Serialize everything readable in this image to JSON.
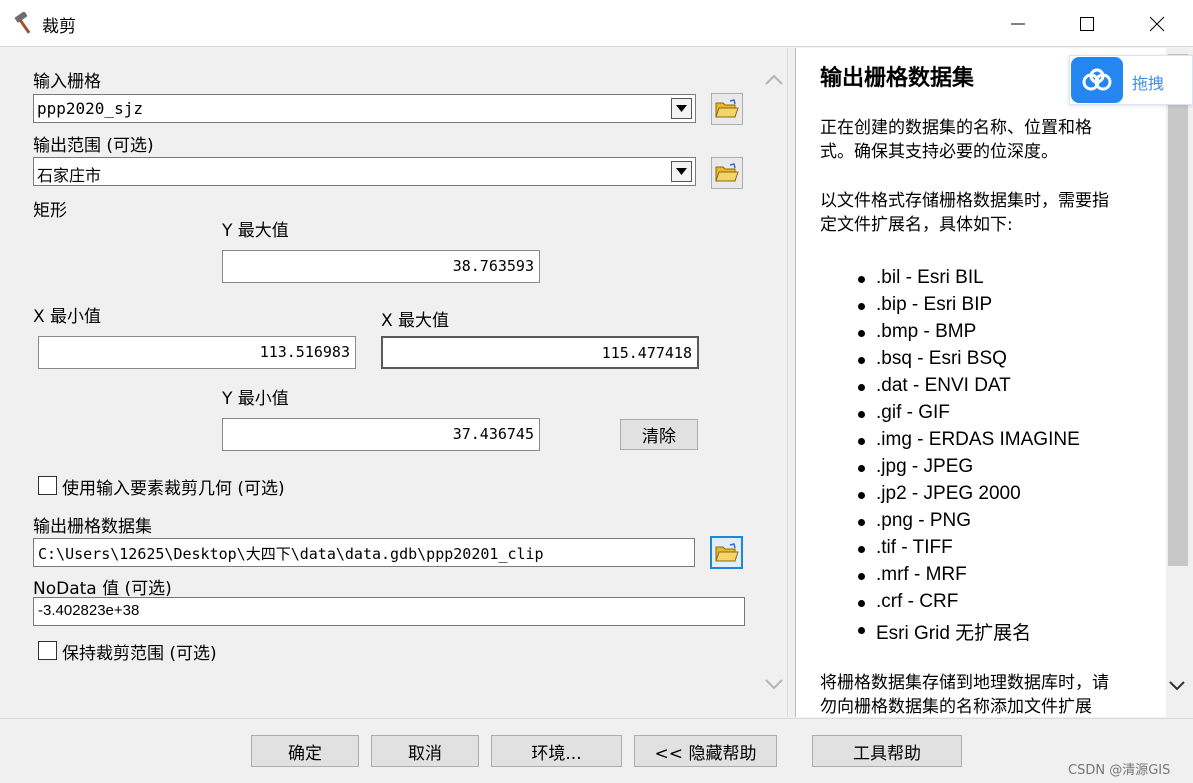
{
  "window": {
    "title": "裁剪",
    "controls": [
      "minimize-icon",
      "maximize-icon",
      "close-icon"
    ]
  },
  "form": {
    "input_raster": {
      "label": "输入栅格",
      "value": "ppp2020_sjz"
    },
    "output_extent": {
      "label": "输出范围 (可选)",
      "value": "石家庄市"
    },
    "rectangle": {
      "label": "矩形",
      "y_max_label": "Y 最大值",
      "y_max": "38.763593",
      "x_min_label": "X 最小值",
      "x_min": "113.516983",
      "x_max_label": "X 最大值",
      "x_max": "115.477418",
      "y_min_label": "Y 最小值",
      "y_min": "37.436745",
      "clear_label": "清除"
    },
    "use_input_features": {
      "label": "使用输入要素裁剪几何 (可选)",
      "checked": false
    },
    "output_raster": {
      "label": "输出栅格数据集",
      "value": "C:\\Users\\12625\\Desktop\\大四下\\data\\data.gdb\\ppp20201_clip"
    },
    "nodata": {
      "label": "NoData 值 (可选)",
      "value": "-3.402823e+38"
    },
    "maintain_extent": {
      "label": "保持裁剪范围 (可选)",
      "checked": false
    }
  },
  "help": {
    "title": "输出栅格数据集",
    "para1": [
      "正在创建的数据集的名称、位置和格",
      "式。确保其支持必要的位深度。"
    ],
    "para2": [
      "以文件格式存储栅格数据集时，需要指",
      "定文件扩展名，具体如下:"
    ],
    "formats": [
      ".bil - Esri BIL",
      ".bip - Esri BIP",
      ".bmp - BMP",
      ".bsq - Esri BSQ",
      ".dat - ENVI DAT",
      ".gif - GIF",
      ".img - ERDAS IMAGINE",
      ".jpg - JPEG",
      ".jp2 - JPEG 2000",
      ".png - PNG",
      ".tif - TIFF",
      ".mrf - MRF",
      ".crf - CRF",
      "Esri Grid 无扩展名"
    ],
    "para3": [
      "将栅格数据集存储到地理数据库时，请",
      "勿向栅格数据集的名称添加文件扩展"
    ]
  },
  "buttons": {
    "ok": "确定",
    "cancel": "取消",
    "environments": "环境...",
    "hide_help": "<< 隐藏帮助",
    "tool_help": "工具帮助"
  },
  "baidu": {
    "text": "拖拽"
  },
  "watermark": "CSDN @清源GIS",
  "colors": {
    "accent": "#1e88d8",
    "baidu_blue": "#2486f0"
  }
}
